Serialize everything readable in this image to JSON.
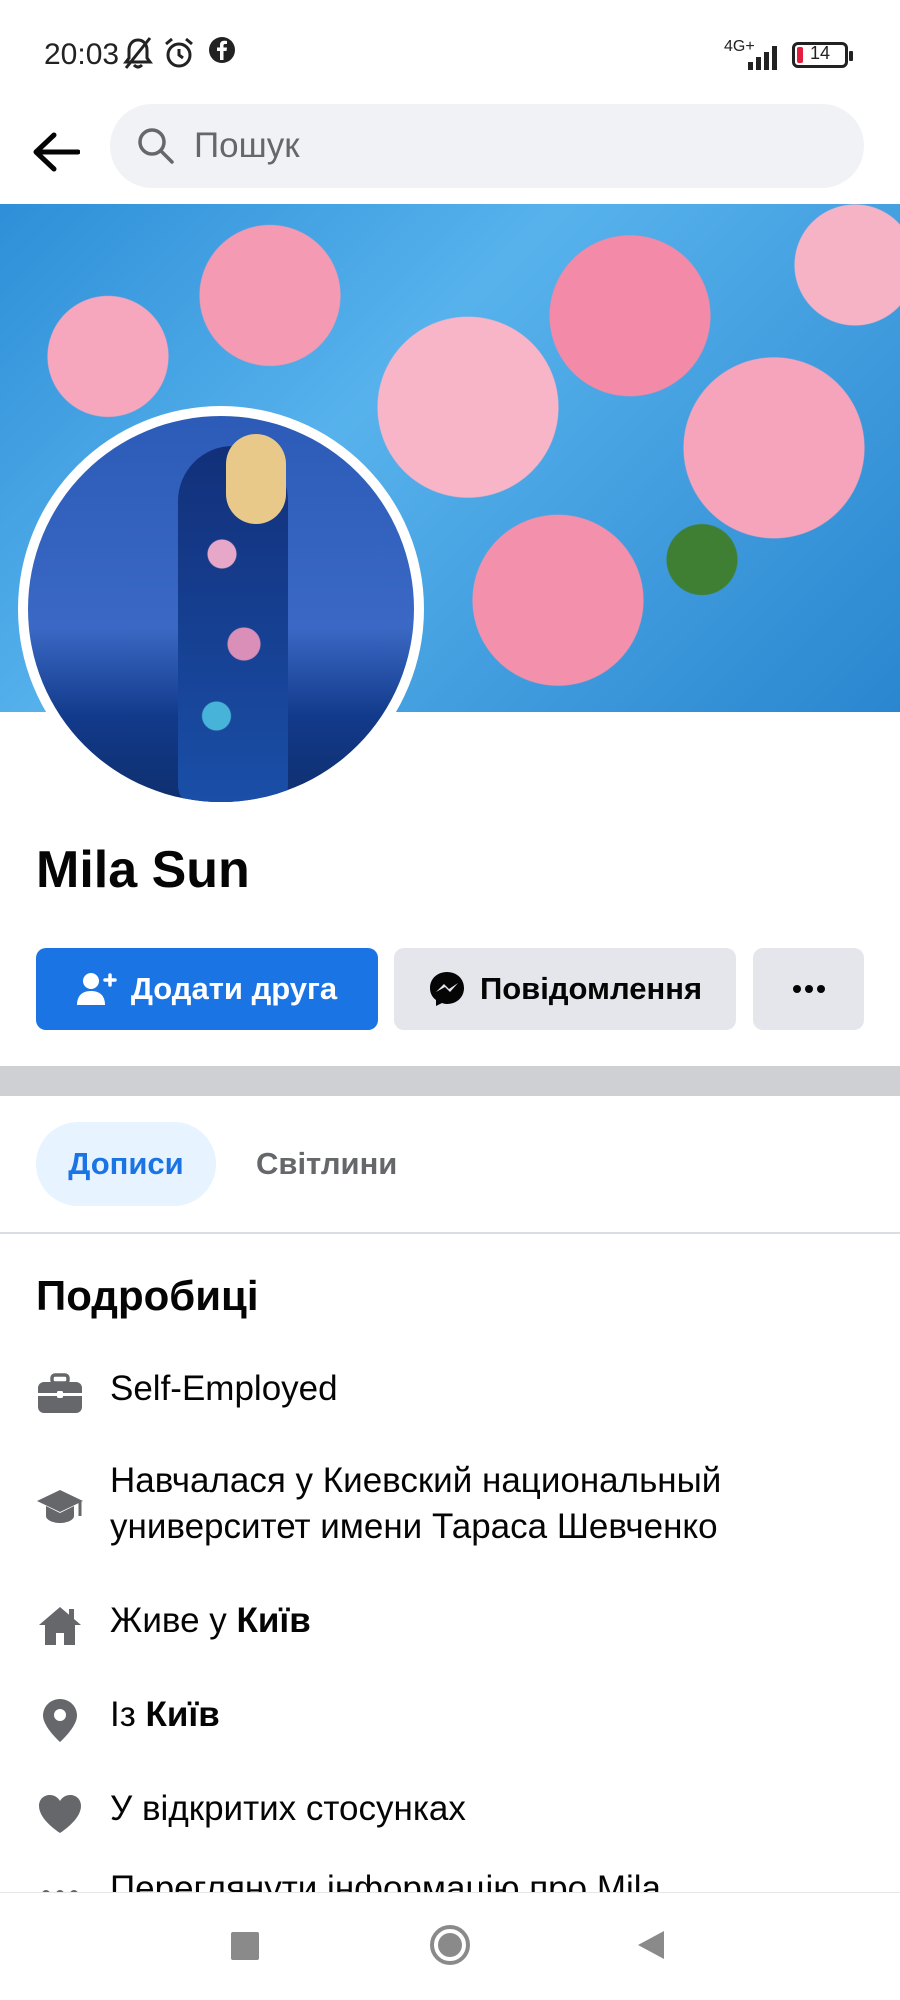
{
  "status_bar": {
    "time": "20:03",
    "network": "4G+",
    "battery": "14",
    "battery_level_percent": 14
  },
  "app_bar": {
    "search_placeholder": "Пошук"
  },
  "profile": {
    "name": "Mila Sun"
  },
  "actions": {
    "add_friend": "Додати друга",
    "message": "Повідомлення"
  },
  "tabs": [
    {
      "label": "Дописи",
      "active": true
    },
    {
      "label": "Світлини",
      "active": false
    }
  ],
  "details": {
    "title": "Подробиці",
    "work": "Self-Employed",
    "education_line1": "Навчалася у Киевский национальный",
    "education_line2": "университет имени Тараса Шевченко",
    "lives_prefix": "Живе у",
    "lives_city": "Київ",
    "from_prefix": "Із",
    "from_city": "Київ",
    "relationship": "У відкритих стосунках",
    "see_about": "Переглянути інформацію про Mila"
  },
  "colors": {
    "accent": "#1b74e4",
    "secondary_button": "#e4e6eb",
    "tab_active_bg": "#e7f3ff",
    "icon_gray": "#65676b"
  }
}
